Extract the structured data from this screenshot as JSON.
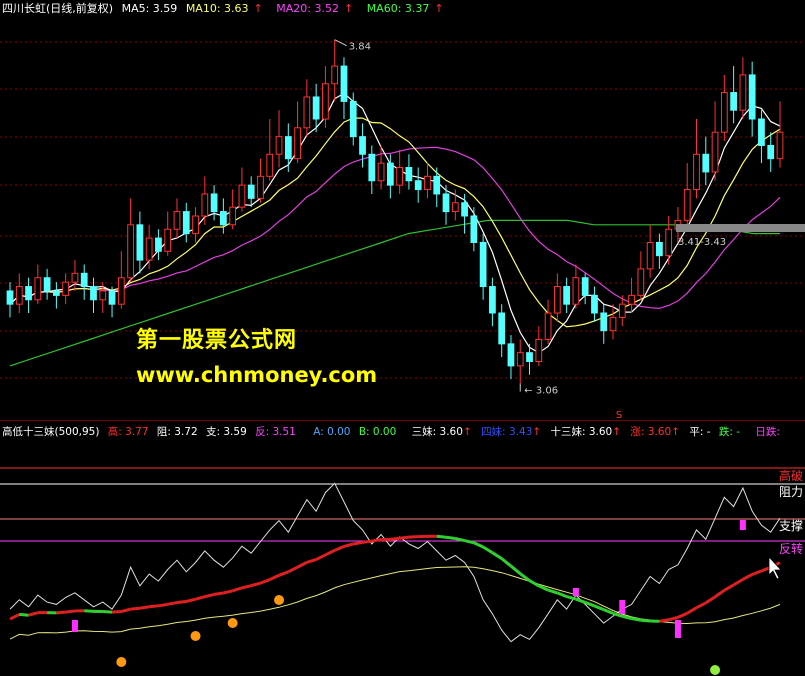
{
  "header": {
    "title": "四川长虹(日线,前复权)",
    "items": [
      {
        "label": "MA5: 3.59",
        "color": "#ffffff",
        "arrow": false
      },
      {
        "label": "MA10: 3.63",
        "color": "#ffff66",
        "arrow": true
      },
      {
        "label": "MA20: 3.52",
        "color": "#ff40ff",
        "arrow": true
      },
      {
        "label": "MA60: 3.37",
        "color": "#40ff40",
        "arrow": true
      }
    ]
  },
  "indicator_header": {
    "name": "高低十三妹(500,95)",
    "items": [
      {
        "label": "高: 3.77",
        "color": "#ff3030",
        "arrow": false
      },
      {
        "label": "阻: 3.72",
        "color": "#ffffff",
        "arrow": false
      },
      {
        "label": "支: 3.59",
        "color": "#ffffff",
        "arrow": false
      },
      {
        "label": "反: 3.51",
        "color": "#ff40ff",
        "arrow": false
      },
      {
        "label": "A: 0.00",
        "color": "#4da6ff",
        "arrow": false
      },
      {
        "label": "B: 0.00",
        "color": "#40ff40",
        "arrow": false
      },
      {
        "label": "三妹: 3.60",
        "color": "#ffffff",
        "arrow": true
      },
      {
        "label": "四妹: 3.43",
        "color": "#3050ff",
        "arrow": true
      },
      {
        "label": "十三妹: 3.60",
        "color": "#ffffff",
        "arrow": true
      },
      {
        "label": "涨: 3.60",
        "color": "#ff3030",
        "arrow": true
      },
      {
        "label": "平: -",
        "color": "#ffffff",
        "arrow": false
      },
      {
        "label": "跌: -",
        "color": "#40ff40",
        "arrow": false
      },
      {
        "label": "日跌:",
        "color": "#ff40ff",
        "arrow": false
      }
    ]
  },
  "price_annotations": {
    "high": "3.84",
    "low": "3.06",
    "range": "3.41-3.43",
    "marker": "S"
  },
  "indicator_labels": {
    "break_high": "高破",
    "resistance": "阻力",
    "support": "支撑",
    "reversal": "反转"
  },
  "watermark": {
    "line1": "第一股票公式网",
    "line2": "www.chnmoney.com"
  },
  "colors": {
    "up": "#ff3232",
    "down": "#54ffff",
    "ma5": "#ffffff",
    "ma10": "#ffff66",
    "ma20": "#e040e0",
    "ma60": "#30c030",
    "grid": "#8b0000"
  },
  "chart_data": {
    "type": "candlestick",
    "ylim": [
      3.0,
      3.88
    ],
    "candles": [
      [
        3.27,
        3.24,
        3.29,
        3.21
      ],
      [
        3.24,
        3.28,
        3.31,
        3.22
      ],
      [
        3.28,
        3.25,
        3.3,
        3.22
      ],
      [
        3.25,
        3.3,
        3.33,
        3.24
      ],
      [
        3.3,
        3.27,
        3.32,
        3.25
      ],
      [
        3.27,
        3.26,
        3.29,
        3.23
      ],
      [
        3.26,
        3.29,
        3.31,
        3.24
      ],
      [
        3.29,
        3.31,
        3.34,
        3.27
      ],
      [
        3.31,
        3.28,
        3.33,
        3.25
      ],
      [
        3.28,
        3.25,
        3.3,
        3.22
      ],
      [
        3.25,
        3.27,
        3.29,
        3.22
      ],
      [
        3.27,
        3.24,
        3.28,
        3.21
      ],
      [
        3.24,
        3.3,
        3.36,
        3.23
      ],
      [
        3.3,
        3.42,
        3.48,
        3.29
      ],
      [
        3.42,
        3.34,
        3.45,
        3.31
      ],
      [
        3.34,
        3.39,
        3.42,
        3.32
      ],
      [
        3.39,
        3.36,
        3.41,
        3.34
      ],
      [
        3.36,
        3.41,
        3.45,
        3.35
      ],
      [
        3.41,
        3.45,
        3.48,
        3.39
      ],
      [
        3.45,
        3.4,
        3.47,
        3.38
      ],
      [
        3.4,
        3.44,
        3.46,
        3.38
      ],
      [
        3.44,
        3.49,
        3.53,
        3.42
      ],
      [
        3.49,
        3.45,
        3.51,
        3.43
      ],
      [
        3.45,
        3.42,
        3.48,
        3.4
      ],
      [
        3.42,
        3.46,
        3.5,
        3.41
      ],
      [
        3.46,
        3.51,
        3.55,
        3.45
      ],
      [
        3.51,
        3.48,
        3.53,
        3.46
      ],
      [
        3.48,
        3.53,
        3.57,
        3.47
      ],
      [
        3.53,
        3.58,
        3.66,
        3.52
      ],
      [
        3.58,
        3.62,
        3.68,
        3.55
      ],
      [
        3.62,
        3.57,
        3.65,
        3.54
      ],
      [
        3.57,
        3.64,
        3.7,
        3.56
      ],
      [
        3.64,
        3.71,
        3.75,
        3.62
      ],
      [
        3.71,
        3.66,
        3.74,
        3.63
      ],
      [
        3.66,
        3.74,
        3.78,
        3.64
      ],
      [
        3.74,
        3.78,
        3.84,
        3.7
      ],
      [
        3.78,
        3.7,
        3.8,
        3.66
      ],
      [
        3.7,
        3.62,
        3.72,
        3.6
      ],
      [
        3.62,
        3.58,
        3.65,
        3.55
      ],
      [
        3.58,
        3.52,
        3.6,
        3.49
      ],
      [
        3.52,
        3.56,
        3.6,
        3.5
      ],
      [
        3.56,
        3.51,
        3.58,
        3.48
      ],
      [
        3.51,
        3.55,
        3.59,
        3.49
      ],
      [
        3.55,
        3.52,
        3.58,
        3.5
      ],
      [
        3.52,
        3.5,
        3.55,
        3.47
      ],
      [
        3.5,
        3.53,
        3.56,
        3.48
      ],
      [
        3.53,
        3.49,
        3.55,
        3.46
      ],
      [
        3.49,
        3.45,
        3.51,
        3.42
      ],
      [
        3.45,
        3.47,
        3.5,
        3.43
      ],
      [
        3.47,
        3.44,
        3.49,
        3.4
      ],
      [
        3.44,
        3.38,
        3.46,
        3.36
      ],
      [
        3.38,
        3.28,
        3.4,
        3.25
      ],
      [
        3.28,
        3.22,
        3.3,
        3.19
      ],
      [
        3.22,
        3.15,
        3.24,
        3.12
      ],
      [
        3.15,
        3.1,
        3.17,
        3.07
      ],
      [
        3.1,
        3.13,
        3.16,
        3.06
      ],
      [
        3.13,
        3.11,
        3.15,
        3.08
      ],
      [
        3.11,
        3.16,
        3.19,
        3.1
      ],
      [
        3.16,
        3.22,
        3.25,
        3.15
      ],
      [
        3.22,
        3.28,
        3.31,
        3.2
      ],
      [
        3.28,
        3.24,
        3.3,
        3.22
      ],
      [
        3.24,
        3.3,
        3.33,
        3.23
      ],
      [
        3.3,
        3.26,
        3.31,
        3.24
      ],
      [
        3.26,
        3.22,
        3.28,
        3.2
      ],
      [
        3.22,
        3.18,
        3.24,
        3.15
      ],
      [
        3.18,
        3.21,
        3.24,
        3.16
      ],
      [
        3.21,
        3.24,
        3.26,
        3.19
      ],
      [
        3.24,
        3.26,
        3.3,
        3.22
      ],
      [
        3.26,
        3.32,
        3.36,
        3.25
      ],
      [
        3.32,
        3.38,
        3.42,
        3.3
      ],
      [
        3.38,
        3.35,
        3.4,
        3.32
      ],
      [
        3.35,
        3.41,
        3.44,
        3.33
      ],
      [
        3.41,
        3.43,
        3.46,
        3.38
      ],
      [
        3.43,
        3.5,
        3.56,
        3.42
      ],
      [
        3.5,
        3.58,
        3.66,
        3.48
      ],
      [
        3.58,
        3.54,
        3.62,
        3.51
      ],
      [
        3.54,
        3.63,
        3.7,
        3.52
      ],
      [
        3.63,
        3.72,
        3.76,
        3.61
      ],
      [
        3.72,
        3.68,
        3.78,
        3.65
      ],
      [
        3.68,
        3.76,
        3.8,
        3.66
      ],
      [
        3.76,
        3.66,
        3.79,
        3.62
      ],
      [
        3.66,
        3.6,
        3.68,
        3.56
      ],
      [
        3.6,
        3.57,
        3.63,
        3.54
      ],
      [
        3.57,
        3.63,
        3.7,
        3.55
      ]
    ],
    "ma60_values": [
      3.1,
      3.12,
      3.14,
      3.16,
      3.18,
      3.2,
      3.22,
      3.24,
      3.26,
      3.28,
      3.3,
      3.32,
      3.34,
      3.36,
      3.38,
      3.4,
      3.41,
      3.42,
      3.43,
      3.43,
      3.43,
      3.43,
      3.42,
      3.42,
      3.42,
      3.42,
      3.41,
      3.41,
      3.4,
      3.4
    ]
  }
}
